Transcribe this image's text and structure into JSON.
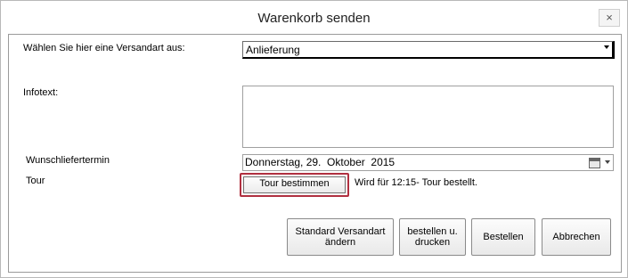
{
  "window": {
    "title": "Warenkorb senden",
    "close_glyph": "×"
  },
  "form": {
    "versandart_label": "Wählen Sie hier eine Versandart aus:",
    "versandart_value": "Anlieferung",
    "infotext_label": "Infotext:",
    "infotext_value": "",
    "wunschliefertermin_label": "Wunschliefertermin",
    "wunschliefertermin_value": "Donnerstag, 29.  Oktober  2015",
    "tour_label": "Tour",
    "tour_button": "Tour bestimmen",
    "tour_status": "Wird für 12:15- Tour bestellt."
  },
  "buttons": {
    "standard_line1": "Standard Versandart",
    "standard_line2": "ändern",
    "print_line1": "bestellen u.",
    "print_line2": "drucken",
    "order": "Bestellen",
    "cancel": "Abbrechen"
  },
  "icons": {
    "calendar": "calendar-icon",
    "dropdown": "chevron-down-icon",
    "close": "close-icon"
  }
}
